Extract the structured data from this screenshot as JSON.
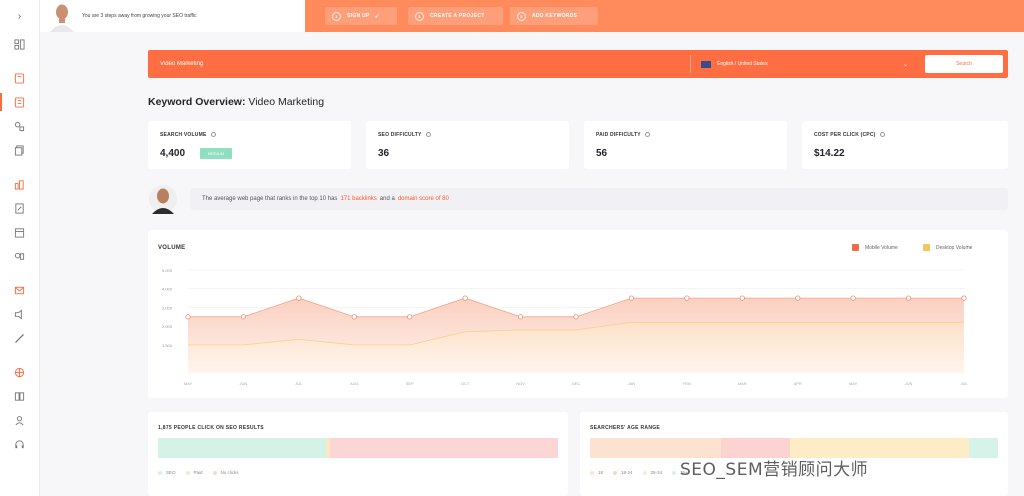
{
  "topbar": {
    "user_message": "You are 3 steps away from growing your SEO traffic",
    "steps": [
      {
        "num": "1",
        "label": "Sign Up",
        "done": true
      },
      {
        "num": "2",
        "label": "Create a project",
        "done": false
      },
      {
        "num": "3",
        "label": "Add keywords",
        "done": false
      }
    ],
    "check_glyph": "✓"
  },
  "search": {
    "value": "Video Marketing",
    "language": "English / United States",
    "button_label": "Search",
    "chevron": "⌄"
  },
  "overview": {
    "heading": "Keyword Overview:",
    "keyword": "Video Marketing"
  },
  "metrics": [
    {
      "label": "SEARCH VOLUME",
      "value": "4,400",
      "badge": "MEDIUM"
    },
    {
      "label": "SEO DIFFICULTY",
      "value": "36"
    },
    {
      "label": "PAID DIFFICULTY",
      "value": "56"
    },
    {
      "label": "COST PER CLICK (CPC)",
      "value": "$14.22"
    }
  ],
  "tip": {
    "prefix": "The average web page that ranks in the top 10 has",
    "backlinks": "171 backlinks",
    "middle": "and a",
    "domain_score": "domain score of 80"
  },
  "chart_data": {
    "type": "area",
    "title": "VOLUME",
    "categories": [
      "MAY",
      "JUN",
      "JUL",
      "AUG",
      "SEP",
      "OCT",
      "NOV",
      "DEC",
      "JAN",
      "FEB",
      "MAR",
      "APR",
      "MAY",
      "JUN",
      "JUL"
    ],
    "series": [
      {
        "name": "Mobile Volume",
        "color": "#f26b4b",
        "values": [
          3000,
          3000,
          4000,
          3000,
          3000,
          4000,
          3000,
          3000,
          4000,
          4000,
          4000,
          4000,
          4000,
          4000,
          4000
        ]
      },
      {
        "name": "Desktop Volume",
        "color": "#f5c65f",
        "values": [
          1500,
          1500,
          1800,
          1500,
          1500,
          2200,
          2300,
          2300,
          2700,
          2700,
          2700,
          2700,
          2700,
          2700,
          2700
        ]
      }
    ],
    "y_ticks": [
      "1,500",
      "2,000",
      "3,000",
      "4,000",
      "5,000"
    ],
    "ylim": [
      0,
      5500
    ],
    "grid": true,
    "legend_position": "top-right"
  },
  "clicks_panel": {
    "title": "1,875 PEOPLE CLICK ON SEO RESULTS",
    "segments": [
      {
        "label": "SEO",
        "fraction": 0.42,
        "color": "#d4f3e6"
      },
      {
        "label": "Paid",
        "fraction": 0.01,
        "color": "#fde6c4"
      },
      {
        "label": "No clicks",
        "fraction": 0.57,
        "color": "#fbd6d4"
      }
    ]
  },
  "age_panel": {
    "title": "SEARCHERS' AGE RANGE",
    "segments": [
      {
        "label": "18",
        "fraction": 0.32,
        "color": "#fde3cf"
      },
      {
        "label": "18-24",
        "fraction": 0.17,
        "color": "#fbd3d0"
      },
      {
        "label": "25-34",
        "fraction": 0.44,
        "color": "#fdecc6"
      },
      {
        "label": "35+",
        "fraction": 0.07,
        "color": "#d6f3ea"
      }
    ]
  },
  "watermark": "SEO_SEM营销顾问大师",
  "sidebar": {
    "expand_glyph": "›"
  }
}
